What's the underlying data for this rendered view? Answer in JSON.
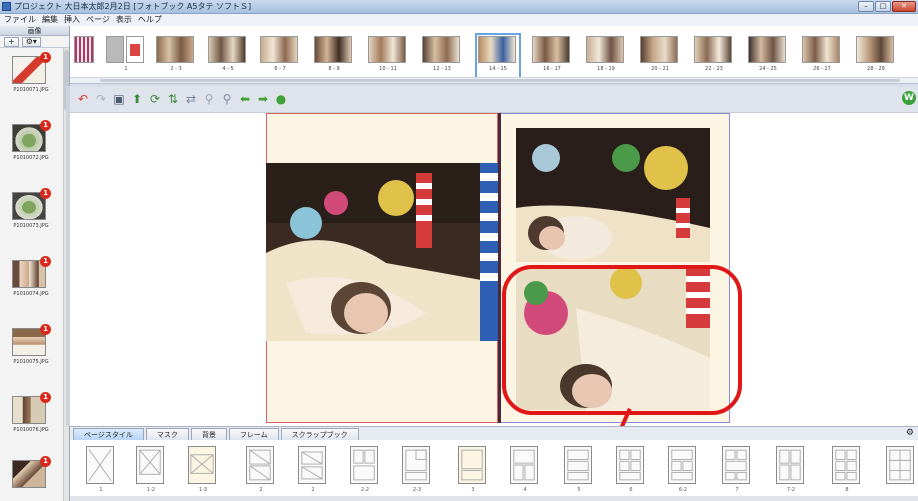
{
  "window": {
    "title": "プロジェクト 大日本太郎2月2日 [フォトブック A5タテ ソフトＳ]",
    "controls": [
      "–",
      "□",
      "✕"
    ]
  },
  "menu": [
    "ファイル",
    "編集",
    "挿入",
    "ページ",
    "表示",
    "ヘルプ"
  ],
  "left_panel": {
    "header": "画像",
    "add_button": "+",
    "options_button": "⚙▾",
    "photos": [
      {
        "file": "P1010071.JPG",
        "badge": "1"
      },
      {
        "file": "P1010072.JPG",
        "badge": "1"
      },
      {
        "file": "P1010073.JPG",
        "badge": "1"
      },
      {
        "file": "P1010074.JPG",
        "badge": "1"
      },
      {
        "file": "P1010075.JPG",
        "badge": "1"
      },
      {
        "file": "P1010076.JPG",
        "badge": "1"
      },
      {
        "file": "",
        "badge": "1"
      }
    ]
  },
  "spreads": [
    "",
    "1",
    "2 - 3",
    "4 - 5",
    "6 - 7",
    "8 - 9",
    "10 - 11",
    "12 - 13",
    "14 - 15",
    "16 - 17",
    "18 - 19",
    "20 - 21",
    "22 - 23",
    "24 - 25",
    "26 - 27",
    "28 - 29"
  ],
  "selected_spread": "14 - 15",
  "toolbar_icons": [
    "undo-icon",
    "redo-icon",
    "save-icon",
    "add-photo-icon",
    "rotate-icon",
    "replace-icon",
    "swap-icon",
    "zoom-out-icon",
    "zoom-in-icon",
    "back-arrow-icon",
    "forward-arrow-icon",
    "play-icon"
  ],
  "bottom_tabs": [
    "ページスタイル",
    "マスク",
    "背景",
    "フレーム",
    "スクラップブック"
  ],
  "active_tab": "ページスタイル",
  "layouts": [
    "1",
    "1-2",
    "1-3",
    "2",
    "2",
    "2-2",
    "2-3",
    "3",
    "4",
    "5",
    "6",
    "6-2",
    "7",
    "7-2",
    "8"
  ],
  "colors": {
    "callout": "#e11616",
    "badge": "#d9291c",
    "page_bg": "#fdf5e4"
  }
}
